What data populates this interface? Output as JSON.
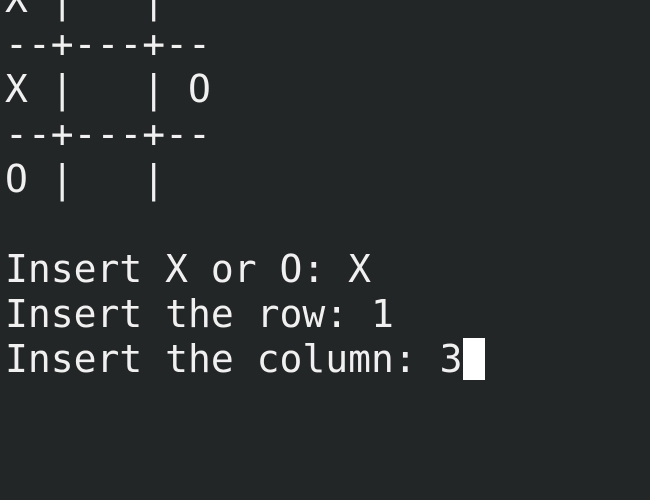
{
  "terminal": {
    "board": [
      "X |   |",
      "--+---+--",
      "X |   | O",
      "--+---+--",
      "O |   |"
    ],
    "blank": "",
    "prompts": [
      "Insert X or O: X",
      "Insert the row: 1",
      "Insert the column: 3"
    ]
  }
}
